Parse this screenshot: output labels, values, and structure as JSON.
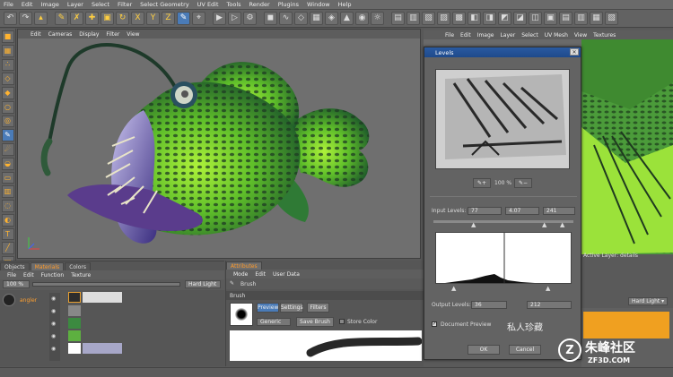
{
  "menu": [
    "File",
    "Edit",
    "Image",
    "Layer",
    "Select",
    "Filter",
    "Select Geometry",
    "UV Edit",
    "Tools",
    "Render",
    "Plugins",
    "Window",
    "Help"
  ],
  "viewport": {
    "menu": [
      "Edit",
      "Cameras",
      "Display",
      "Filter",
      "View"
    ]
  },
  "uv": {
    "menu": [
      "File",
      "Edit",
      "Image",
      "Layer",
      "Select",
      "UV Mesh",
      "View",
      "Textures"
    ],
    "active_layer": "Active Layer: details",
    "blend": "Hard Light",
    "blend_arrow": "▾"
  },
  "bottom_left": {
    "tabs": [
      "Objects",
      "Materials",
      "Colors"
    ],
    "menu": [
      "File",
      "Edit",
      "Function",
      "Texture"
    ],
    "zoom": "100 %",
    "blend": "Hard Light",
    "layer_name": "angler"
  },
  "attributes": {
    "tab": "Attributes",
    "menu": [
      "Mode",
      "Edit",
      "User Data"
    ],
    "brush_label": "Brush",
    "section": "Brush",
    "subtabs": [
      "Preview",
      "Settings",
      "Filters"
    ],
    "preset": "Generic",
    "save_btn": "Save Brush",
    "store_color": "Store Color"
  },
  "levels": {
    "title": "Levels",
    "zoom": "100 %",
    "input_label": "Input Levels:",
    "input_values": [
      "77",
      "4.07",
      "241"
    ],
    "output_label": "Output Levels:",
    "output_values": [
      "36",
      "212"
    ],
    "doc_preview": "Document Preview",
    "ok": "OK",
    "cancel": "Cancel"
  },
  "watermarks": [
    "私人珍藏",
    "ZF3D.COM",
    "朱峰社区"
  ]
}
